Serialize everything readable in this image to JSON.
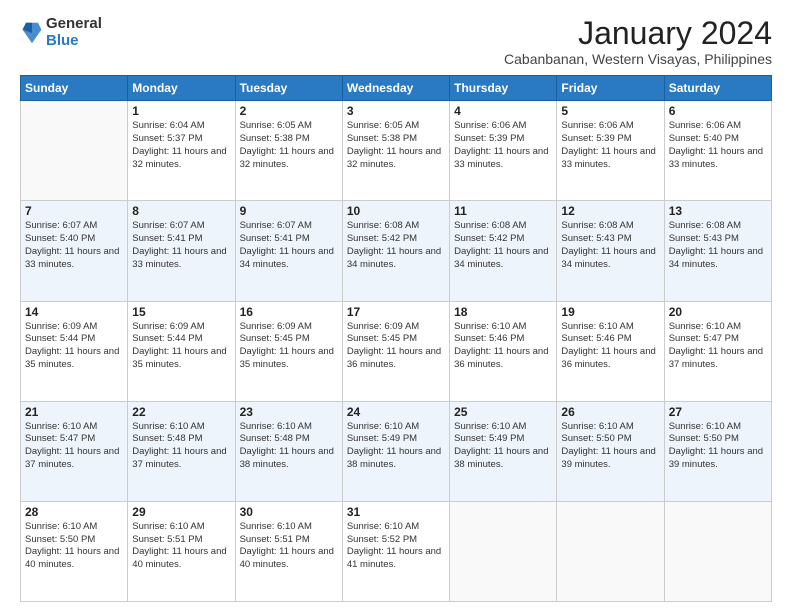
{
  "logo": {
    "general": "General",
    "blue": "Blue"
  },
  "header": {
    "month": "January 2024",
    "location": "Cabanbanan, Western Visayas, Philippines"
  },
  "weekdays": [
    "Sunday",
    "Monday",
    "Tuesday",
    "Wednesday",
    "Thursday",
    "Friday",
    "Saturday"
  ],
  "rows": [
    [
      {
        "day": "",
        "empty": true
      },
      {
        "day": "1",
        "sunrise": "Sunrise: 6:04 AM",
        "sunset": "Sunset: 5:37 PM",
        "daylight": "Daylight: 11 hours and 32 minutes."
      },
      {
        "day": "2",
        "sunrise": "Sunrise: 6:05 AM",
        "sunset": "Sunset: 5:38 PM",
        "daylight": "Daylight: 11 hours and 32 minutes."
      },
      {
        "day": "3",
        "sunrise": "Sunrise: 6:05 AM",
        "sunset": "Sunset: 5:38 PM",
        "daylight": "Daylight: 11 hours and 32 minutes."
      },
      {
        "day": "4",
        "sunrise": "Sunrise: 6:06 AM",
        "sunset": "Sunset: 5:39 PM",
        "daylight": "Daylight: 11 hours and 33 minutes."
      },
      {
        "day": "5",
        "sunrise": "Sunrise: 6:06 AM",
        "sunset": "Sunset: 5:39 PM",
        "daylight": "Daylight: 11 hours and 33 minutes."
      },
      {
        "day": "6",
        "sunrise": "Sunrise: 6:06 AM",
        "sunset": "Sunset: 5:40 PM",
        "daylight": "Daylight: 11 hours and 33 minutes."
      }
    ],
    [
      {
        "day": "7",
        "sunrise": "Sunrise: 6:07 AM",
        "sunset": "Sunset: 5:40 PM",
        "daylight": "Daylight: 11 hours and 33 minutes."
      },
      {
        "day": "8",
        "sunrise": "Sunrise: 6:07 AM",
        "sunset": "Sunset: 5:41 PM",
        "daylight": "Daylight: 11 hours and 33 minutes."
      },
      {
        "day": "9",
        "sunrise": "Sunrise: 6:07 AM",
        "sunset": "Sunset: 5:41 PM",
        "daylight": "Daylight: 11 hours and 34 minutes."
      },
      {
        "day": "10",
        "sunrise": "Sunrise: 6:08 AM",
        "sunset": "Sunset: 5:42 PM",
        "daylight": "Daylight: 11 hours and 34 minutes."
      },
      {
        "day": "11",
        "sunrise": "Sunrise: 6:08 AM",
        "sunset": "Sunset: 5:42 PM",
        "daylight": "Daylight: 11 hours and 34 minutes."
      },
      {
        "day": "12",
        "sunrise": "Sunrise: 6:08 AM",
        "sunset": "Sunset: 5:43 PM",
        "daylight": "Daylight: 11 hours and 34 minutes."
      },
      {
        "day": "13",
        "sunrise": "Sunrise: 6:08 AM",
        "sunset": "Sunset: 5:43 PM",
        "daylight": "Daylight: 11 hours and 34 minutes."
      }
    ],
    [
      {
        "day": "14",
        "sunrise": "Sunrise: 6:09 AM",
        "sunset": "Sunset: 5:44 PM",
        "daylight": "Daylight: 11 hours and 35 minutes."
      },
      {
        "day": "15",
        "sunrise": "Sunrise: 6:09 AM",
        "sunset": "Sunset: 5:44 PM",
        "daylight": "Daylight: 11 hours and 35 minutes."
      },
      {
        "day": "16",
        "sunrise": "Sunrise: 6:09 AM",
        "sunset": "Sunset: 5:45 PM",
        "daylight": "Daylight: 11 hours and 35 minutes."
      },
      {
        "day": "17",
        "sunrise": "Sunrise: 6:09 AM",
        "sunset": "Sunset: 5:45 PM",
        "daylight": "Daylight: 11 hours and 36 minutes."
      },
      {
        "day": "18",
        "sunrise": "Sunrise: 6:10 AM",
        "sunset": "Sunset: 5:46 PM",
        "daylight": "Daylight: 11 hours and 36 minutes."
      },
      {
        "day": "19",
        "sunrise": "Sunrise: 6:10 AM",
        "sunset": "Sunset: 5:46 PM",
        "daylight": "Daylight: 11 hours and 36 minutes."
      },
      {
        "day": "20",
        "sunrise": "Sunrise: 6:10 AM",
        "sunset": "Sunset: 5:47 PM",
        "daylight": "Daylight: 11 hours and 37 minutes."
      }
    ],
    [
      {
        "day": "21",
        "sunrise": "Sunrise: 6:10 AM",
        "sunset": "Sunset: 5:47 PM",
        "daylight": "Daylight: 11 hours and 37 minutes."
      },
      {
        "day": "22",
        "sunrise": "Sunrise: 6:10 AM",
        "sunset": "Sunset: 5:48 PM",
        "daylight": "Daylight: 11 hours and 37 minutes."
      },
      {
        "day": "23",
        "sunrise": "Sunrise: 6:10 AM",
        "sunset": "Sunset: 5:48 PM",
        "daylight": "Daylight: 11 hours and 38 minutes."
      },
      {
        "day": "24",
        "sunrise": "Sunrise: 6:10 AM",
        "sunset": "Sunset: 5:49 PM",
        "daylight": "Daylight: 11 hours and 38 minutes."
      },
      {
        "day": "25",
        "sunrise": "Sunrise: 6:10 AM",
        "sunset": "Sunset: 5:49 PM",
        "daylight": "Daylight: 11 hours and 38 minutes."
      },
      {
        "day": "26",
        "sunrise": "Sunrise: 6:10 AM",
        "sunset": "Sunset: 5:50 PM",
        "daylight": "Daylight: 11 hours and 39 minutes."
      },
      {
        "day": "27",
        "sunrise": "Sunrise: 6:10 AM",
        "sunset": "Sunset: 5:50 PM",
        "daylight": "Daylight: 11 hours and 39 minutes."
      }
    ],
    [
      {
        "day": "28",
        "sunrise": "Sunrise: 6:10 AM",
        "sunset": "Sunset: 5:50 PM",
        "daylight": "Daylight: 11 hours and 40 minutes."
      },
      {
        "day": "29",
        "sunrise": "Sunrise: 6:10 AM",
        "sunset": "Sunset: 5:51 PM",
        "daylight": "Daylight: 11 hours and 40 minutes."
      },
      {
        "day": "30",
        "sunrise": "Sunrise: 6:10 AM",
        "sunset": "Sunset: 5:51 PM",
        "daylight": "Daylight: 11 hours and 40 minutes."
      },
      {
        "day": "31",
        "sunrise": "Sunrise: 6:10 AM",
        "sunset": "Sunset: 5:52 PM",
        "daylight": "Daylight: 11 hours and 41 minutes."
      },
      {
        "day": "",
        "empty": true
      },
      {
        "day": "",
        "empty": true
      },
      {
        "day": "",
        "empty": true
      }
    ]
  ]
}
